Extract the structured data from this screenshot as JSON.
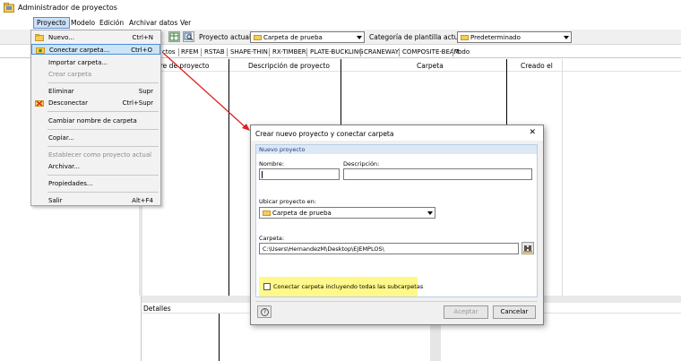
{
  "window": {
    "title": "Administrador de proyectos"
  },
  "menubar": {
    "items": [
      "Proyecto",
      "Modelo",
      "Edición",
      "Archivar datos",
      "Ver"
    ]
  },
  "toolbar": {
    "current_project_label": "Proyecto actual:",
    "current_project_value": "Carpeta de prueba",
    "template_category_label": "Categoría de plantilla actual",
    "template_category_value": "Predeterminado"
  },
  "tabs": {
    "items": [
      "ctos",
      "RFEM",
      "RSTAB",
      "SHAPE-THIN",
      "RX-TIMBER",
      "PLATE-BUCKLING",
      "CRANEWAY",
      "COMPOSITE-BEAM",
      "Todo"
    ]
  },
  "table": {
    "columns": [
      "bre de proyecto",
      "Descripción de proyecto",
      "Carpeta",
      "Creado el"
    ]
  },
  "details": {
    "label": "Detalles"
  },
  "context_menu": {
    "items": [
      {
        "label": "Nuevo...",
        "shortcut": "Ctrl+N",
        "icon": "folder-icon"
      },
      {
        "label": "Conectar carpeta...",
        "shortcut": "Ctrl+O",
        "icon": "connect-folder-icon"
      },
      {
        "label": "Importar carpeta...",
        "shortcut": ""
      },
      {
        "label": "Crear carpeta",
        "shortcut": ""
      },
      {
        "label": "Eliminar",
        "shortcut": "Supr"
      },
      {
        "label": "Desconectar",
        "shortcut": "Ctrl+Supr",
        "icon": "disconnect-icon"
      },
      {
        "label": "Cambiar nombre de carpeta",
        "shortcut": ""
      },
      {
        "label": "Copiar...",
        "shortcut": ""
      },
      {
        "label": "Establecer como proyecto actual",
        "shortcut": ""
      },
      {
        "label": "Archivar...",
        "shortcut": ""
      },
      {
        "label": "Propiedades...",
        "shortcut": ""
      },
      {
        "label": "Salir",
        "shortcut": "Alt+F4"
      }
    ]
  },
  "dialog": {
    "title": "Crear nuevo proyecto y conectar carpeta",
    "group_title": "Nuevo proyecto",
    "name_label": "Nombre:",
    "name_value": "",
    "description_label": "Descripción:",
    "description_value": "",
    "location_label": "Ubicar proyecto en:",
    "location_value": "Carpeta de prueba",
    "folder_label": "Carpeta:",
    "folder_value": "C:\\Users\\HernandezM\\Desktop\\EJEMPLOS\\",
    "subfolders_checkbox_label": "Conectar carpeta incluyendo todas las subcarpetas",
    "subfolders_checked": false,
    "accept_label": "Aceptar",
    "cancel_label": "Cancelar",
    "close_glyph": "✕",
    "help_glyph": "?"
  },
  "colors": {
    "highlight_yellow": "#fff88a",
    "selection_blue": "#cce4f7",
    "arrow_red": "#e02020",
    "folder_yellow": "#f6cd58"
  }
}
